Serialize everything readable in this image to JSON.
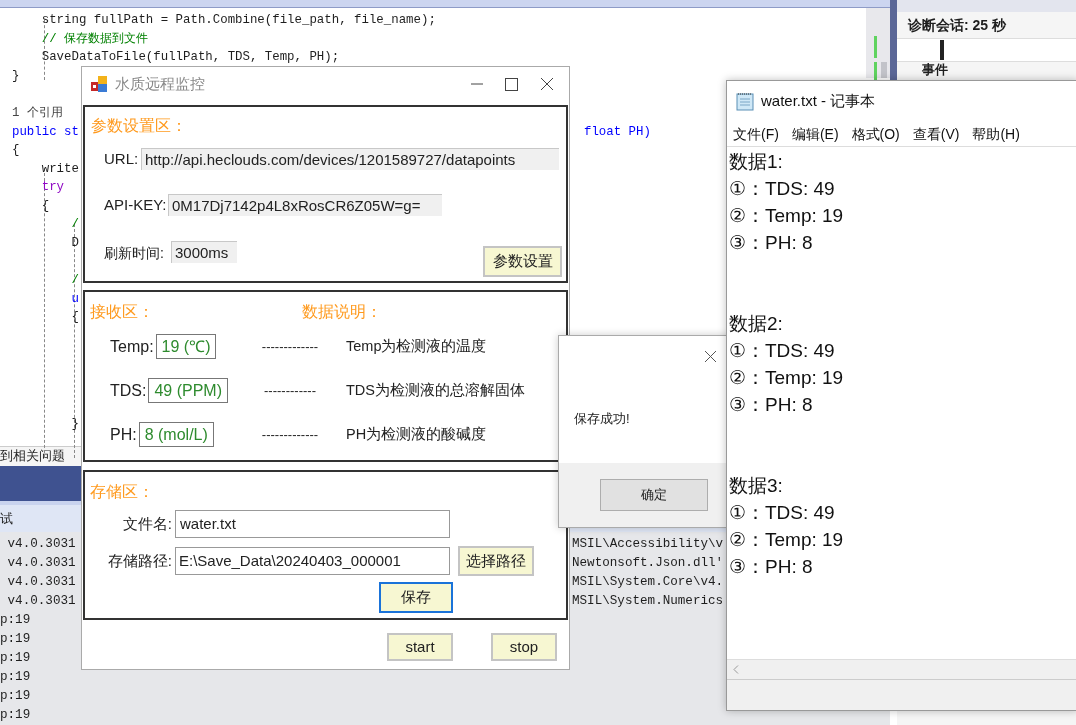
{
  "ide": {
    "editor_blocks": [
      [
        {
          "text": "    string fullPath = Path.Combine(file_path, file_name);",
          "kind": "code"
        },
        {
          "text": "    // 保存数据到文件",
          "kind": "comment"
        },
        {
          "text": "    SaveDataToFile(fullPath, TDS, Temp, PH);",
          "kind": "code"
        },
        {
          "text": "}",
          "kind": "code"
        }
      ],
      [
        {
          "text": "1 个引用",
          "kind": "note"
        },
        {
          "text": "public st",
          "kind": "keyword",
          "tail": "float PH)"
        },
        {
          "text": "{",
          "kind": "code"
        },
        {
          "text": "    write",
          "kind": "code"
        },
        {
          "text": "    try",
          "kind": "control"
        },
        {
          "text": "    {",
          "kind": "code"
        },
        {
          "text": "        /",
          "kind": "comment"
        },
        {
          "text": "        D",
          "kind": "code"
        }
      ],
      [
        {
          "text": "        /",
          "kind": "comment"
        },
        {
          "text": "        u",
          "kind": "keyword"
        },
        {
          "text": "        {",
          "kind": "code"
        }
      ],
      [
        {
          "text": "        }",
          "kind": "code"
        }
      ]
    ],
    "problems_link": "到相关问题",
    "output_tab": "试",
    "output_lines": [
      {
        "text": " v4.0.3031",
        "tail": "MSIL\\Accessibility\\v"
      },
      {
        "text": " v4.0.3031",
        "tail": "Newtonsoft.Json.dll'"
      },
      {
        "text": " v4.0.3031",
        "tail": "MSIL\\System.Core\\v4."
      },
      {
        "text": " v4.0.3031",
        "tail": "MSIL\\System.Numerics"
      },
      {
        "text": "p:19"
      },
      {
        "text": "p:19"
      },
      {
        "text": "p:19"
      },
      {
        "text": "p:19"
      },
      {
        "text": "p:19"
      },
      {
        "text": "p:19"
      }
    ],
    "diagnostics": {
      "title": "诊断会话: 25 秒",
      "section": "事件"
    }
  },
  "main_window": {
    "title": "水质远程监控",
    "settings": {
      "heading": "参数设置区：",
      "url_label": "URL:",
      "url": "http://api.heclouds.com/devices/1201589727/datapoints",
      "key_label": "API-KEY:",
      "key": "0M17Dj7142p4L8xRosCR6Z05W=g=",
      "refresh_label": "刷新时间:",
      "refresh": "3000ms",
      "button": "参数设置"
    },
    "receive": {
      "heading": "接收区：",
      "explain_heading": "数据说明：",
      "readings": [
        {
          "label": "Temp:",
          "value": "19 (℃)",
          "dashes": "-------------",
          "description": "Temp为检测液的温度"
        },
        {
          "label": "TDS:",
          "value": "49 (PPM)",
          "dashes": "------------",
          "description": "TDS为检测液的总溶解固体"
        },
        {
          "label": "PH:",
          "value": "8 (mol/L)",
          "dashes": "-------------",
          "description": "PH为检测液的酸碱度"
        }
      ]
    },
    "storage": {
      "heading": "存储区：",
      "name_label": "文件名:",
      "name": "water.txt",
      "path_label": "存储路径:",
      "path": "E:\\Save_Data\\20240403_000001",
      "browse_button": "选择路径",
      "save_button": "保存",
      "save_focused": true
    },
    "buttons": [
      "start",
      "stop"
    ]
  },
  "message_box": {
    "message": "保存成功!",
    "button": "确定"
  },
  "notepad": {
    "title": "water.txt - 记事本",
    "menu": [
      "文件(F)",
      "编辑(E)",
      "格式(O)",
      "查看(V)",
      "帮助(H)"
    ],
    "blocks": [
      {
        "heading": "数据1:",
        "lines": [
          "①：TDS: 49",
          "②：Temp: 19",
          "③：PH: 8"
        ]
      },
      {
        "heading": "数据2:",
        "lines": [
          "①：TDS: 49",
          "②：Temp: 19",
          "③：PH: 8"
        ]
      },
      {
        "heading": "数据3:",
        "lines": [
          "①：TDS: 49",
          "②：Temp: 19",
          "③：PH: 8"
        ]
      }
    ]
  }
}
